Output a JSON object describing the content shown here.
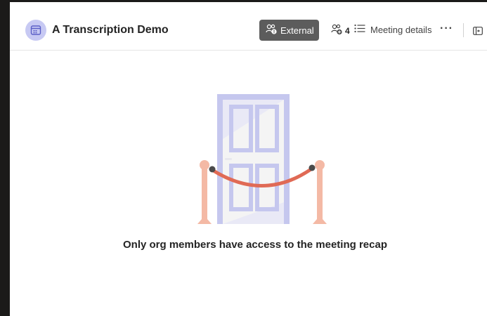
{
  "header": {
    "title": "A Transcription Demo",
    "external_label": "External",
    "participants_count": "4",
    "meeting_details_label": "Meeting details",
    "more_label": "···"
  },
  "main": {
    "message": "Only org members have access to the meeting recap"
  },
  "icons": {
    "meeting": "calendar-icon",
    "external": "external-people-icon",
    "participants": "people-icon",
    "details": "list-icon",
    "panel": "open-panel-icon",
    "illustration": "door-rope-illustration"
  },
  "colors": {
    "accent": "#5b5fc7",
    "icon_bg": "#c7c9f3",
    "external_bg": "#5c5c5c",
    "door": "#c5c7ee",
    "rope": "#e06a55",
    "post": "#f4b9a5"
  }
}
